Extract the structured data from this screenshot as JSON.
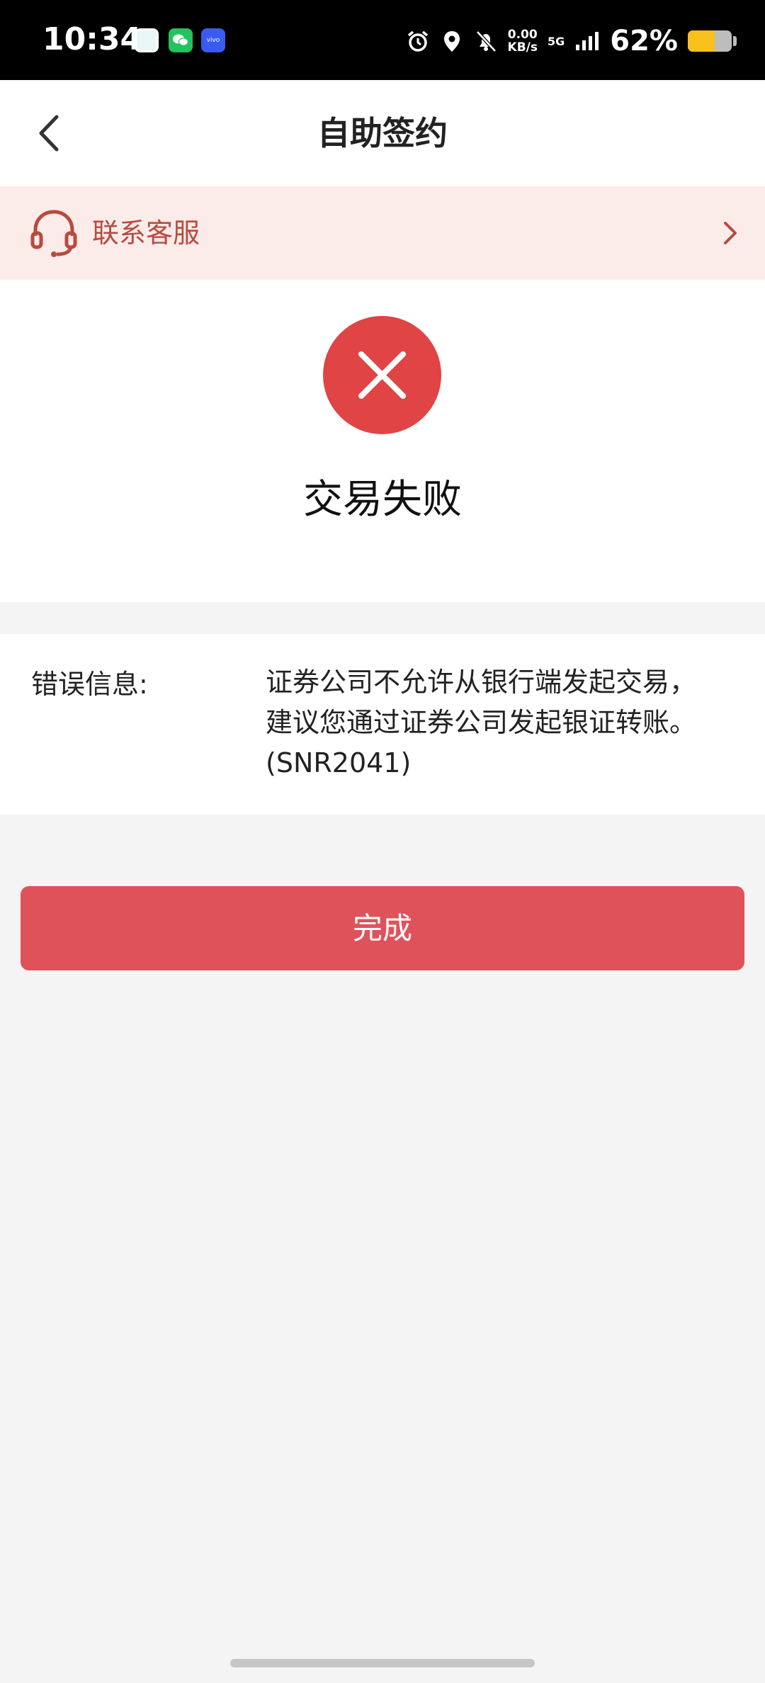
{
  "status_bar": {
    "time": "10:34",
    "app_icons": [
      "gallery-icon",
      "wechat-icon",
      "vivo-icon"
    ],
    "vivo_label": "vivo",
    "net_speed_value": "0.00",
    "net_speed_unit": "KB/s",
    "network": "5G",
    "battery_percent": "62%",
    "battery_level": 0.62
  },
  "navbar": {
    "title": "自助签约",
    "back_icon": "chevron-left-icon"
  },
  "service": {
    "label": "联系客服",
    "icon": "headset-icon",
    "color": "#b84a40"
  },
  "result": {
    "status_icon": "close-icon",
    "title": "交易失败",
    "accent": "#e04444"
  },
  "error": {
    "label": "错误信息:",
    "message": "证券公司不允许从银行端发起交易，\n建议您通过证券公司发起银证转账。\n(SNR2041)"
  },
  "actions": {
    "done_label": "完成",
    "done_color": "#e0525a"
  }
}
